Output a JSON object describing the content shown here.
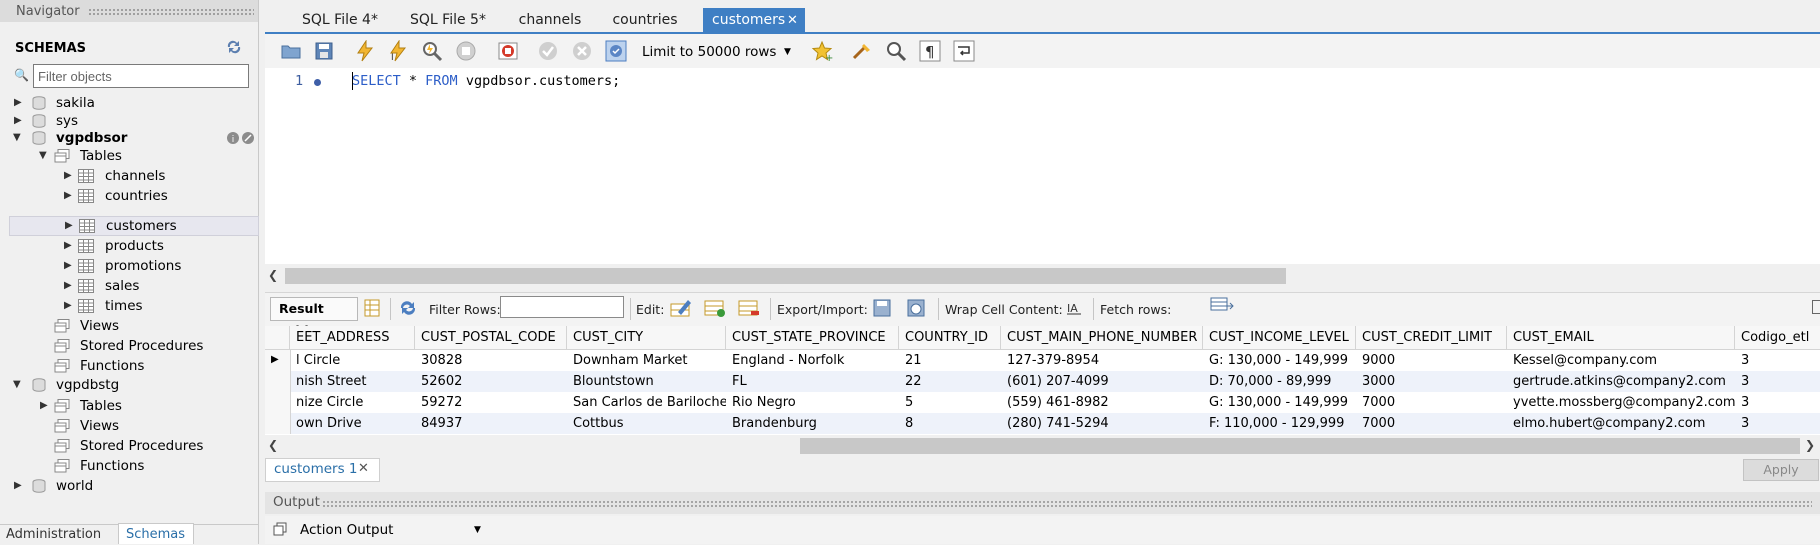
{
  "navigator": {
    "title": "Navigator",
    "section": "SCHEMAS",
    "filter_placeholder": "Filter objects",
    "tree": {
      "sakila": "sakila",
      "sys": "sys",
      "vgpdbsor": "vgpdbsor",
      "tables": "Tables",
      "tables_list": [
        "channels",
        "countries",
        "customers",
        "products",
        "promotions",
        "sales",
        "times"
      ],
      "views": "Views",
      "stored_procedures": "Stored Procedures",
      "functions": "Functions",
      "vgpdbstg": "vgpdbstg",
      "stg_tables": "Tables",
      "stg_views": "Views",
      "stg_stored_procedures": "Stored Procedures",
      "stg_functions": "Functions",
      "world": "world"
    },
    "bottom_tabs": {
      "administration": "Administration",
      "schemas": "Schemas"
    }
  },
  "editor_tabs": [
    "SQL File 4*",
    "SQL File 5*",
    "channels",
    "countries",
    "customers"
  ],
  "toolbar": {
    "limit": "Limit to 50000 rows"
  },
  "editor": {
    "line_number": "1",
    "sql_kw1": "SELECT",
    "sql_mid": " * ",
    "sql_kw2": "FROM",
    "sql_rest": " vgpdbsor.customers;"
  },
  "result_toolbar": {
    "result_grid": "Result Grid",
    "filter_rows": "Filter Rows:",
    "edit": "Edit:",
    "export_import": "Export/Import:",
    "wrap_cell": "Wrap Cell Content:",
    "fetch_rows": "Fetch rows:"
  },
  "grid": {
    "columns": [
      "EET_ADDRESS",
      "CUST_POSTAL_CODE",
      "CUST_CITY",
      "CUST_STATE_PROVINCE",
      "COUNTRY_ID",
      "CUST_MAIN_PHONE_NUMBER",
      "CUST_INCOME_LEVEL",
      "CUST_CREDIT_LIMIT",
      "CUST_EMAIL",
      "Codigo_etl"
    ],
    "rows": [
      [
        "l Circle",
        "30828",
        "Downham Market",
        "England - Norfolk",
        "21",
        "127-379-8954",
        "G: 130,000 - 149,999",
        "9000",
        "Kessel@company.com",
        "3"
      ],
      [
        "nish Street",
        "52602",
        "Blountstown",
        "FL",
        "22",
        "(601) 207-4099",
        "D: 70,000 - 89,999",
        "3000",
        "gertrude.atkins@company2.com",
        "3"
      ],
      [
        "nize Circle",
        "59272",
        "San Carlos de Bariloche",
        "Rio Negro",
        "5",
        "(559) 461-8982",
        "G: 130,000 - 149,999",
        "7000",
        "yvette.mossberg@company2.com",
        "3"
      ],
      [
        "own Drive",
        "84937",
        "Cottbus",
        "Brandenburg",
        "8",
        "(280) 741-5294",
        "F: 110,000 - 129,999",
        "7000",
        "elmo.hubert@company2.com",
        "3"
      ]
    ]
  },
  "result_tab": "customers 1",
  "apply": "Apply",
  "output": {
    "title": "Output",
    "action": "Action Output"
  },
  "colors": {
    "accent": "#3f7fc4",
    "keyword": "#2d5ec8"
  }
}
